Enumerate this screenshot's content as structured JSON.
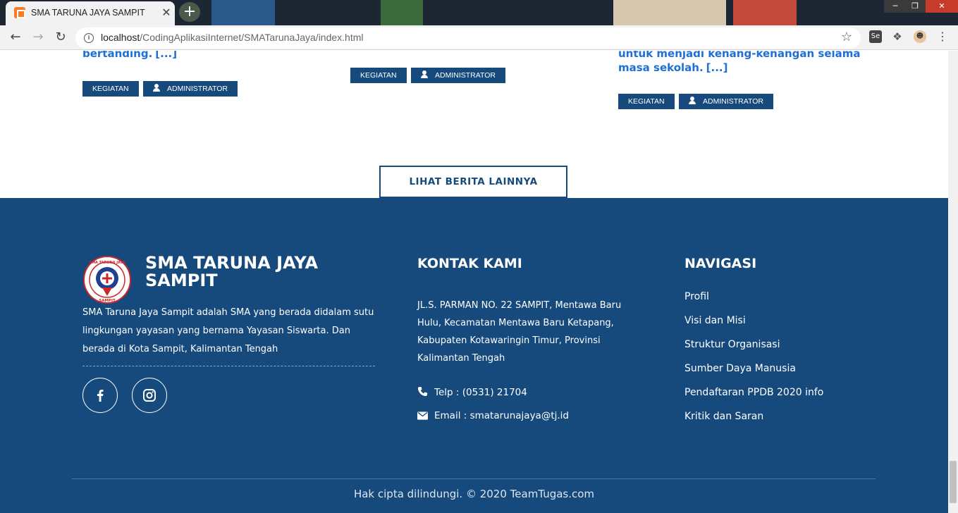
{
  "browser": {
    "tab_title": "SMA TARUNA JAYA SAMPIT",
    "tab_close": "✕",
    "new_tab": "+",
    "url_host": "localhost",
    "url_path": "/CodingAplikasiInternet/SMATarunaJaya/index.html",
    "ext_se_label": "Se"
  },
  "news_cards": [
    {
      "excerpt_tail": "bertanding.",
      "read_more": "[...]",
      "category": "KEGIATAN",
      "author": "ADMINISTRATOR"
    },
    {
      "category": "KEGIATAN",
      "author": "ADMINISTRATOR"
    },
    {
      "excerpt_line1": "untuk menjadi kenang-kenangan selama",
      "excerpt_line2": "masa sekolah.",
      "read_more": "[...]",
      "category": "KEGIATAN",
      "author": "ADMINISTRATOR"
    }
  ],
  "more_news_button": "LIHAT BERITA LAINNYA",
  "footer": {
    "school_name": "SMA TARUNA JAYA SAMPIT",
    "logo_text_top": "SMA TARUNA JAYA",
    "logo_text_bottom": "SAMPIT",
    "about": "SMA Taruna Jaya Sampit adalah SMA yang berada didalam sutu lingkungan yayasan yang bernama Yayasan Siswarta. Dan berada di Kota Sampit, Kalimantan Tengah",
    "contact_title": "KONTAK KAMI",
    "address": "JL.S. PARMAN NO. 22 SAMPIT, Mentawa Baru Hulu, Kecamatan Mentawa Baru Ketapang, Kabupaten Kotawaringin Timur, Provinsi Kalimantan Tengah",
    "phone": "Telp : (0531) 21704",
    "email": "Email : smatarunajaya@tj.id",
    "nav_title": "NAVIGASI",
    "nav_links": [
      "Profil",
      "Visi dan Misi",
      "Struktur Organisasi",
      "Sumber Daya Manusia",
      "Pendaftaran PPDB 2020 info",
      "Kritik dan Saran"
    ],
    "copyright": "Hak cipta dilindungi. © 2020 TeamTugas.com"
  },
  "colors": {
    "primary": "#174a7c",
    "link": "#1e6fd6"
  }
}
